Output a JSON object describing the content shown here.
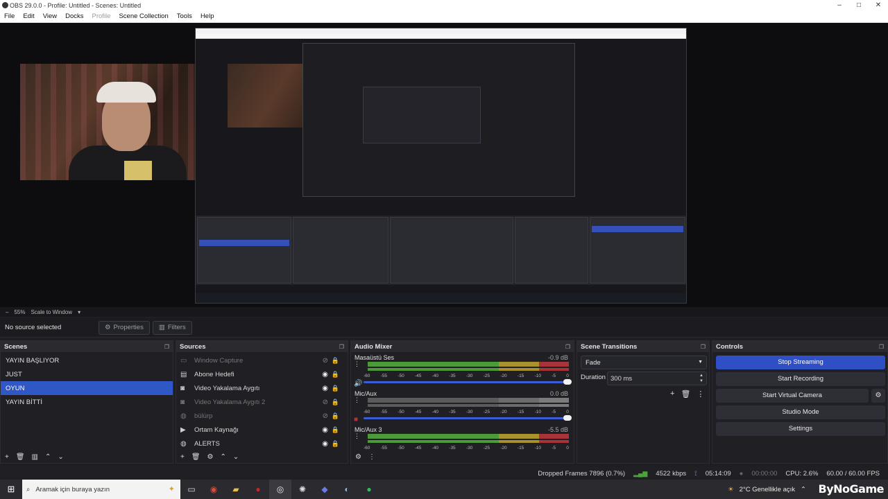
{
  "window": {
    "title": "OBS 29.0.0 - Profile: Untitled - Scenes: Untitled"
  },
  "menu": [
    "File",
    "Edit",
    "View",
    "Docks",
    "Profile",
    "Scene Collection",
    "Tools",
    "Help"
  ],
  "zoom": {
    "percent": "55%",
    "mode": "Scale to Window"
  },
  "props": {
    "no_source": "No source selected",
    "properties": "Properties",
    "filters": "Filters"
  },
  "scenes": {
    "title": "Scenes",
    "items": [
      "YAYIN BAŞLIYOR",
      "JUST",
      "OYUN",
      "YAYIN BİTTİ"
    ],
    "selected": "OYUN"
  },
  "sources": {
    "title": "Sources",
    "items": [
      {
        "label": "Window Capture",
        "icon": "window-icon",
        "visible": false
      },
      {
        "label": "Abone Hedefi",
        "icon": "text-icon",
        "visible": true
      },
      {
        "label": "Video Yakalama Aygıtı",
        "icon": "camera-icon",
        "visible": true
      },
      {
        "label": "Video Yakalama Aygıtı 2",
        "icon": "camera-icon",
        "visible": false
      },
      {
        "label": "bülürp",
        "icon": "globe-icon",
        "visible": false
      },
      {
        "label": "Ortam Kaynağı",
        "icon": "play-icon",
        "visible": true
      },
      {
        "label": "ALERTS",
        "icon": "globe-icon",
        "visible": true
      }
    ]
  },
  "mixer": {
    "title": "Audio Mixer",
    "ticks": [
      "-60",
      "-55",
      "-50",
      "-45",
      "-40",
      "-35",
      "-30",
      "-25",
      "-20",
      "-15",
      "-10",
      "-5",
      "0"
    ],
    "channels": [
      {
        "name": "Masaüstü Ses",
        "db": "-0.9 dB",
        "active": true,
        "muted": false
      },
      {
        "name": "Mic/Aux",
        "db": "0.0 dB",
        "active": false,
        "muted": true
      },
      {
        "name": "Mic/Aux 3",
        "db": "-5.5 dB",
        "active": true,
        "muted": false
      }
    ]
  },
  "transitions": {
    "title": "Scene Transitions",
    "type": "Fade",
    "duration_label": "Duration",
    "duration": "300 ms"
  },
  "controls": {
    "title": "Controls",
    "stop_streaming": "Stop Streaming",
    "start_recording": "Start Recording",
    "start_virtual_camera": "Start Virtual Camera",
    "studio_mode": "Studio Mode",
    "settings": "Settings"
  },
  "status": {
    "dropped": "Dropped Frames 7896 (0.7%)",
    "kbps": "4522 kbps",
    "live_time": "05:14:09",
    "rec_time": "00:00:00",
    "cpu": "CPU: 2.6%",
    "fps": "60.00 / 60.00 FPS"
  },
  "taskbar": {
    "search_placeholder": "Aramak için buraya yazın",
    "weather": "2°C  Genellikle açık",
    "brand": "ByNoGame"
  },
  "colors": {
    "accent": "#2f57c6",
    "panel": "#1f1f24",
    "meter_green": "#4d9a3b"
  }
}
